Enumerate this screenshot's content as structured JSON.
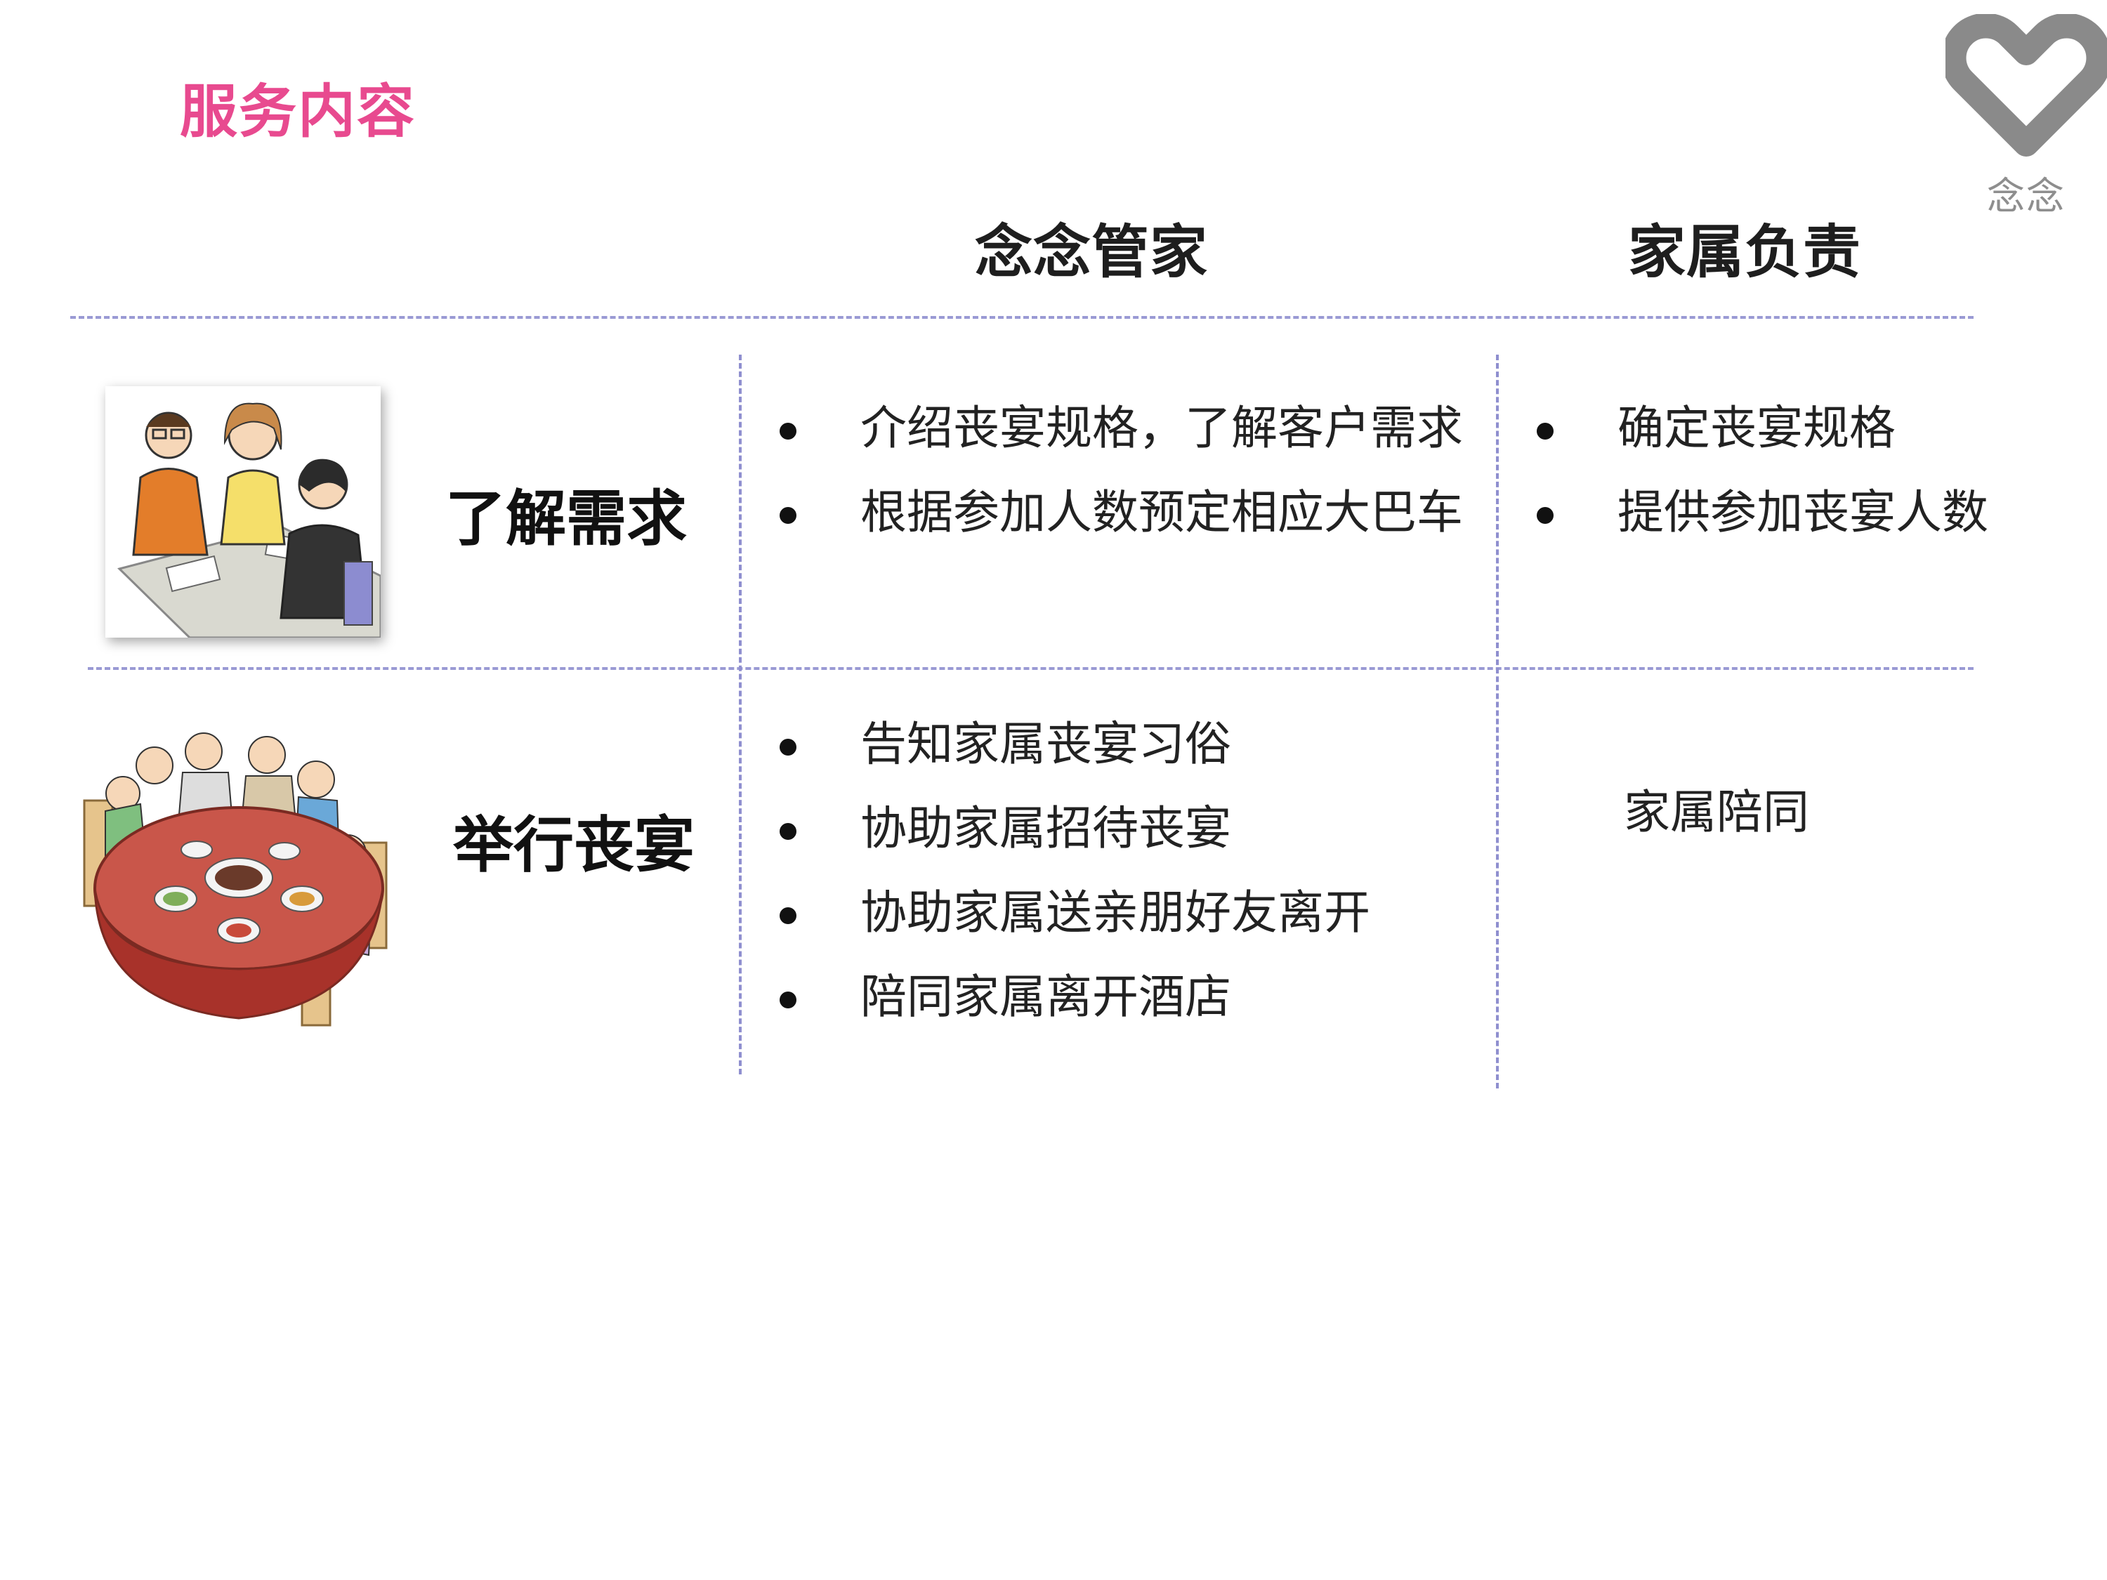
{
  "page": {
    "title": "服务内容",
    "accent_color": "#e84a8f",
    "divider_color": "#9a9ad4"
  },
  "logo": {
    "icon": "heart-logo-icon",
    "text": "念念"
  },
  "table": {
    "headers": {
      "col1": "念念管家",
      "col2": "家属负责"
    },
    "rows": [
      {
        "label": "了解需求",
        "illustration": "meeting-illustration-icon",
        "butler": [
          "介绍丧宴规格，了解客户需求",
          "根据参加人数预定相应大巴车"
        ],
        "family": [
          "确定丧宴规格",
          "提供参加丧宴人数"
        ]
      },
      {
        "label": "举行丧宴",
        "illustration": "banquet-illustration-icon",
        "butler": [
          "告知家属丧宴习俗",
          "协助家属招待丧宴",
          "协助家属送亲朋好友离开",
          "陪同家属离开酒店"
        ],
        "family_text": "家属陪同"
      }
    ]
  }
}
